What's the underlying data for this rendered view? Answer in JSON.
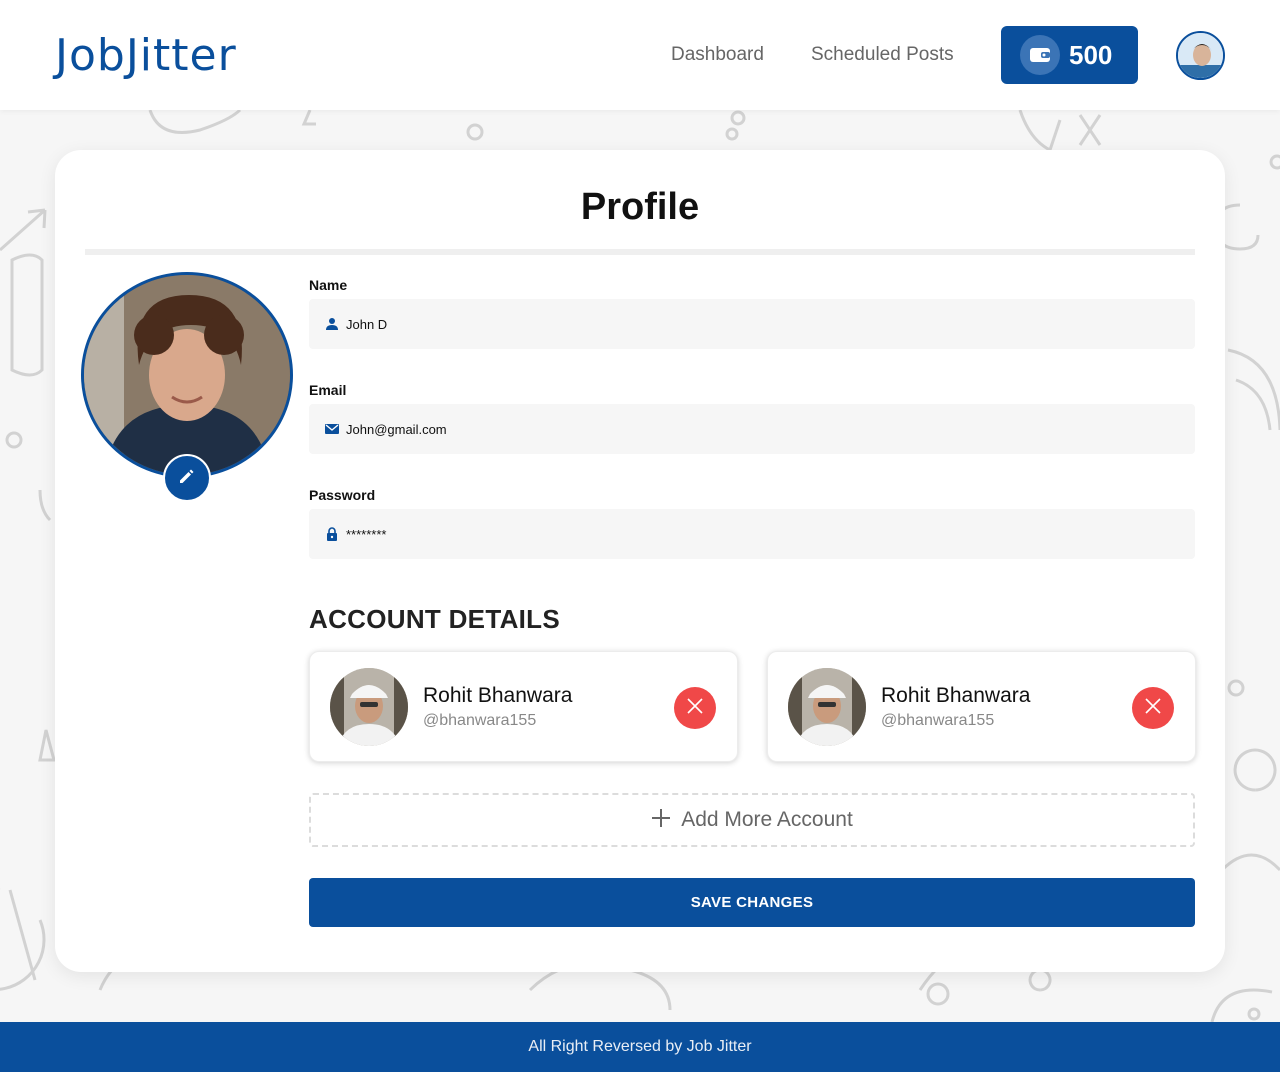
{
  "brand": {
    "logo_text": "JobJitter",
    "accent": "#0a4f9c"
  },
  "nav": {
    "items": [
      {
        "label": "Dashboard"
      },
      {
        "label": "Scheduled Posts"
      }
    ],
    "wallet": {
      "icon": "wallet-icon",
      "balance": "500"
    },
    "user_avatar": "user-avatar"
  },
  "profile": {
    "title": "Profile",
    "photo": "profile-photo",
    "edit_icon": "pencil-icon",
    "fields": {
      "name": {
        "label": "Name",
        "value": "John D",
        "icon": "person-icon"
      },
      "email": {
        "label": "Email",
        "value": "John@gmail.com",
        "icon": "mail-icon"
      },
      "password": {
        "label": "Password",
        "value": "********",
        "icon": "lock-icon"
      }
    }
  },
  "accounts": {
    "title": "ACCOUNT DETAILS",
    "items": [
      {
        "name": "Rohit Bhanwara",
        "handle": "@bhanwara155",
        "remove_icon": "close-icon",
        "remove_color": "#f04848"
      },
      {
        "name": "Rohit Bhanwara",
        "handle": "@bhanwara155",
        "remove_icon": "close-icon",
        "remove_color": "#f04848"
      }
    ],
    "add_label": "Add More Account",
    "save_label": "SAVE CHANGES"
  },
  "footer": {
    "text": "All Right Reversed by Job Jitter"
  }
}
